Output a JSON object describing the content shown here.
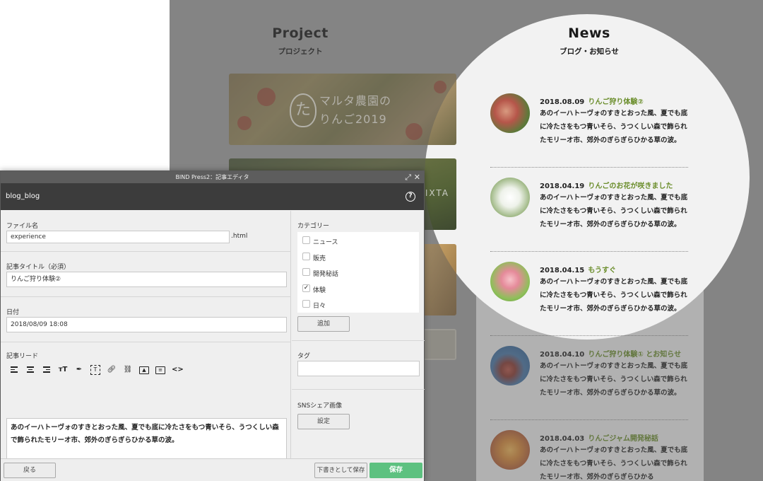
{
  "site": {
    "project": {
      "heading": "Project",
      "subheading": "プロジェクト"
    },
    "news": {
      "heading": "News",
      "subheading": "ブログ・お知らせ"
    },
    "project_card": {
      "logo_line1": "マルタ農園の",
      "logo_line2": "りんご2019",
      "logo_mark": "た",
      "stock_label": "PIXTA"
    },
    "news_items": [
      {
        "date": "2018.08.09",
        "title": "りんご狩り体験②",
        "text": "あのイーハトーヴォのすきとおった風、夏でも底に冷たさをもつ青いそら、うつくしい森で飾られたモリーオ市、郊外のぎらぎらひかる草の波。"
      },
      {
        "date": "2018.04.19",
        "title": "りんごのお花が咲きました",
        "text": "あのイーハトーヴォのすきとおった風、夏でも底に冷たさをもつ青いそら、うつくしい森で飾られたモリーオ市、郊外のぎらぎらひかる草の波。"
      },
      {
        "date": "2018.04.15",
        "title": "もうすぐ",
        "text": "あのイーハトーヴォのすきとおった風、夏でも底に冷たさをもつ青いそら、うつくしい森で飾られたモリーオ市、郊外のぎらぎらひかる草の波。"
      },
      {
        "date": "2018.04.10",
        "title": "りんご狩り体験① とお知らせ",
        "text": "あのイーハトーヴォのすきとおった風、夏でも底に冷たさをもつ青いそら、うつくしい森で飾られたモリーオ市、郊外のぎらぎらひかる草の波。"
      },
      {
        "date": "2018.04.03",
        "title": "りんごジャム開発秘話",
        "text": "あのイーハトーヴォのすきとおった風、夏でも底に冷たさをもつ青いそら、うつくしい森で飾られたモリーオ市、郊外のぎらぎらひかる"
      }
    ],
    "colors": {
      "accent_green": "#6a8d2a",
      "overlay": "#a3a3a3"
    }
  },
  "dialog": {
    "window_title": "BIND Press2：記事エディタ",
    "header_title": "blog_blog",
    "file": {
      "label": "ファイル名",
      "value": "experience",
      "suffix": ".html"
    },
    "title_field": {
      "label": "記事タイトル（必須）",
      "value": "りんご狩り体験②"
    },
    "date_field": {
      "label": "日付",
      "value": "2018/08/09 18:08"
    },
    "lead": {
      "label": "記事リード",
      "value": "あのイーハトーヴォのすきとおった風、夏でも底に冷たさをもつ青いそら、うつくしい森で飾られたモリーオ市、郊外のぎらぎらひかる草の波。"
    },
    "category": {
      "label": "カテゴリー",
      "items": [
        {
          "label": "ニュース",
          "checked": false
        },
        {
          "label": "販売",
          "checked": false
        },
        {
          "label": "開発秘話",
          "checked": false
        },
        {
          "label": "体験",
          "checked": true
        },
        {
          "label": "日々",
          "checked": false
        }
      ],
      "add_button": "追加"
    },
    "tag": {
      "label": "タグ",
      "value": ""
    },
    "sns": {
      "label": "SNSシェア画像",
      "button": "設定"
    },
    "footer": {
      "back": "戻る",
      "draft": "下書きとして保存",
      "save": "保存"
    },
    "colors": {
      "save_button": "#5dc180",
      "header": "#3c3c3c",
      "titlebar": "#5d5d5d"
    }
  }
}
